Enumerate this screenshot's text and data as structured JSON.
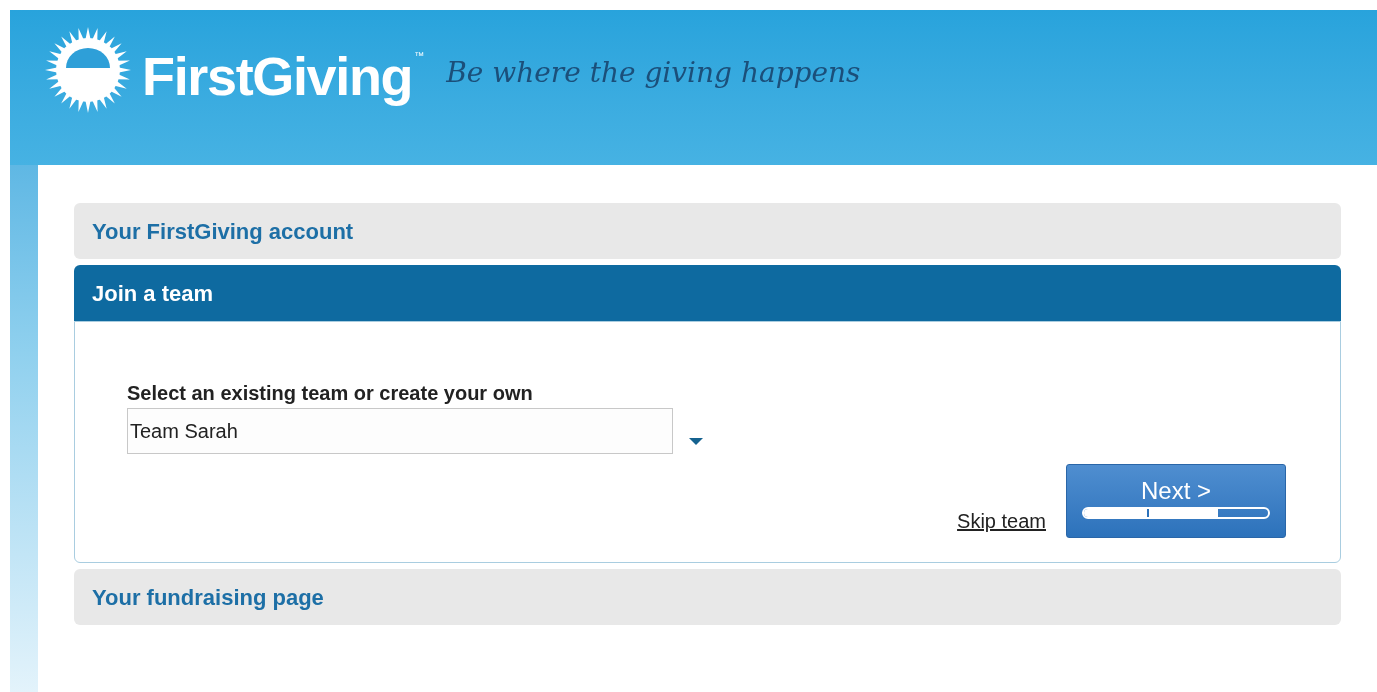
{
  "header": {
    "brand": "FirstGiving",
    "trademark": "™",
    "tagline": "Be where the giving happens"
  },
  "sections": [
    {
      "title": "Your FirstGiving account",
      "expanded": false
    },
    {
      "title": "Join a team",
      "expanded": true,
      "field_label": "Select an existing team or create your own",
      "team_value": "Team Sarah",
      "skip_link": "Skip team",
      "next_button": {
        "label": "Next >",
        "level": 0.73
      }
    },
    {
      "title": "Your fundraising page",
      "expanded": false
    }
  ]
}
